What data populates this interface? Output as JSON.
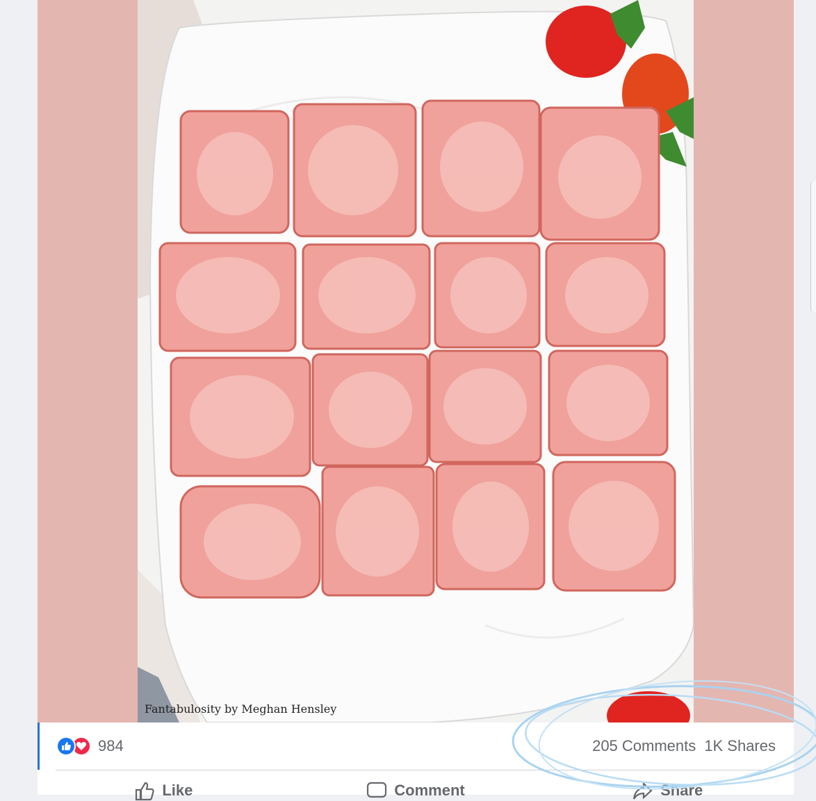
{
  "post": {
    "photo_credit": "Fantabulosity by Meghan Hensley",
    "background_color": "#e4b6b0"
  },
  "stats": {
    "reaction_icons": [
      "like-icon",
      "love-icon"
    ],
    "reaction_count": "984",
    "comments": "205 Comments",
    "shares": "1K Shares"
  },
  "actions": {
    "like_label": "Like",
    "comment_label": "Comment",
    "share_label": "Share"
  }
}
